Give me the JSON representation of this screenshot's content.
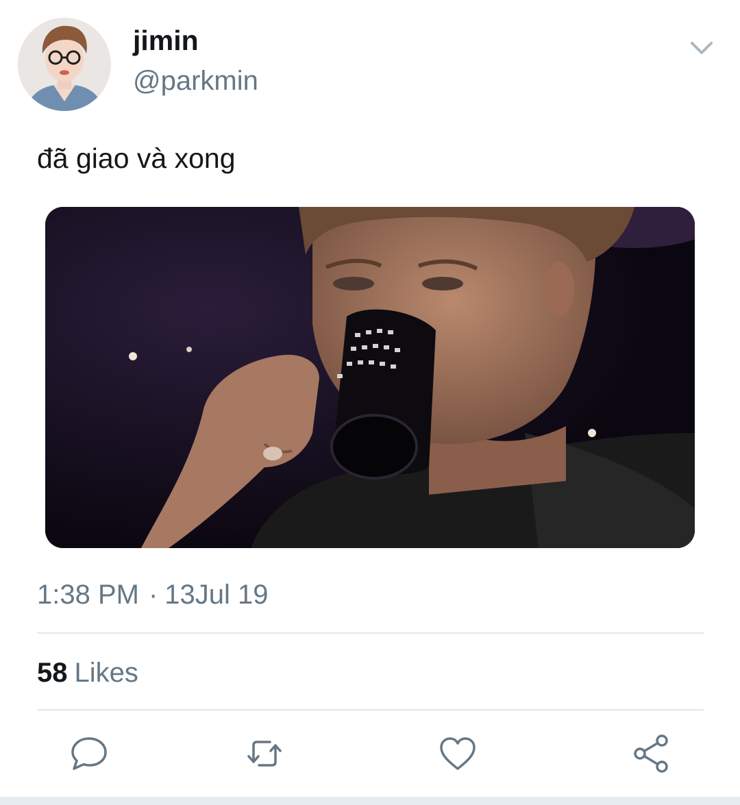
{
  "tweet": {
    "author": {
      "display_name": "jimin",
      "handle": "@parkmin",
      "avatar_icon": "profile-avatar"
    },
    "text": "đã giao và xong",
    "media": {
      "kind": "image",
      "description_icon": "tweet-photo"
    },
    "time": "1:38 PM",
    "separator": "·",
    "date": "13Jul 19",
    "likes": {
      "count": "58",
      "label": "Likes"
    },
    "menu_icon": "chevron-down-icon",
    "actions": [
      {
        "name": "reply",
        "icon": "comment-icon"
      },
      {
        "name": "retweet",
        "icon": "retweet-icon"
      },
      {
        "name": "like",
        "icon": "heart-icon"
      },
      {
        "name": "share",
        "icon": "share-icon"
      }
    ]
  },
  "colors": {
    "primary_text": "#14171a",
    "secondary_text": "#657786",
    "divider": "#e1e8ed",
    "icon": "#657786"
  }
}
